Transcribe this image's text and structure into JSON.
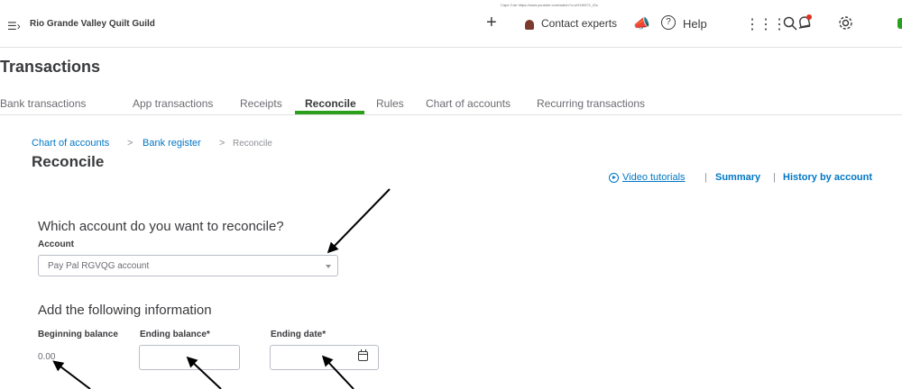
{
  "topbar": {
    "company_name": "Rio Grande Valley Quilt Guild",
    "tooltip_text": "Cape Carr https://www.youtube.com/watch?v=uH1W0?1_iGc",
    "contact_label": "Contact experts",
    "help_label": "Help",
    "icons": [
      "menu-icon",
      "plus-icon",
      "megaphone-icon",
      "help-icon",
      "apps-grid-icon",
      "search-icon",
      "bell-icon",
      "gear-icon"
    ]
  },
  "page_title": "Transactions",
  "tabs": [
    {
      "label": "Bank transactions"
    },
    {
      "label": "App transactions"
    },
    {
      "label": "Receipts"
    },
    {
      "label": "Reconcile"
    },
    {
      "label": "Rules"
    },
    {
      "label": "Chart of accounts"
    },
    {
      "label": "Recurring transactions"
    }
  ],
  "active_tab": "Reconcile",
  "breadcrumb": {
    "chart": "Chart of accounts",
    "sep": ">",
    "register": "Bank register",
    "current": "Reconcile"
  },
  "section_title": "Reconcile",
  "links": {
    "video": "Video tutorials",
    "sep": "|",
    "summary": "Summary",
    "history": "History by account"
  },
  "question": "Which account do you want to reconcile?",
  "account": {
    "label": "Account",
    "value": "Pay Pal RGVQG account"
  },
  "info": {
    "title": "Add the following information",
    "beginning_balance_label": "Beginning balance",
    "beginning_balance_value": "0.00",
    "ending_balance_label": "Ending balance*",
    "ending_balance_value": "",
    "ending_date_label": "Ending date*",
    "ending_date_value": ""
  },
  "colors": {
    "accent_green": "#2ca01c",
    "link_blue": "#0077c5",
    "text": "#393a3d"
  }
}
